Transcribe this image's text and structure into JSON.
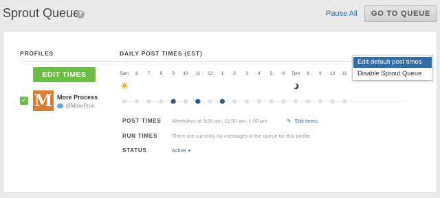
{
  "header": {
    "title": "Sprout Queue",
    "help_glyph": "?",
    "pause_label": "Pause All",
    "goto_label": "GO TO QUEUE"
  },
  "columns": {
    "profiles": "PROFILES",
    "daily_post_times": "DAILY POST TIMES (EST)"
  },
  "profiles_panel": {
    "edit_times_label": "EDIT TIMES"
  },
  "profile": {
    "avatar_letter": "M",
    "name": "More Process",
    "handle": "@MoreProc",
    "checked": true,
    "network_icon": "twitter-icon"
  },
  "timeline": {
    "hours": [
      "5am",
      "6",
      "7",
      "8",
      "9",
      "10",
      "11",
      "12",
      "1",
      "2",
      "3",
      "4",
      "5",
      "6",
      "7pm",
      "8",
      "9",
      "10",
      "11"
    ],
    "active_hours": [
      "9",
      "11",
      "1"
    ],
    "day_start_icon": "sun-icon",
    "night_icon": "moon-icon"
  },
  "details": {
    "post_times_label": "POST TIMES",
    "post_times_value": "Weekdays at 9:00 am, 11:00 am, 1:00 pm",
    "edit_times_link": "Edit times",
    "run_times_label": "RUN TIMES",
    "run_times_value": "There are currently no messages in the queue for this profile.",
    "status_label": "STATUS",
    "status_value": "Active"
  },
  "settings_menu": {
    "items": [
      "Edit default post times",
      "Disable Sprout Queue"
    ],
    "highlighted_index": 0
  },
  "colors": {
    "accent_green": "#6bbd45",
    "link_blue": "#2d6ea5",
    "dot_active": "#2a5a8c",
    "dot_inactive": "#e0e0e0",
    "menu_highlight": "#2f6dab",
    "avatar_orange": "#e07b2e"
  }
}
